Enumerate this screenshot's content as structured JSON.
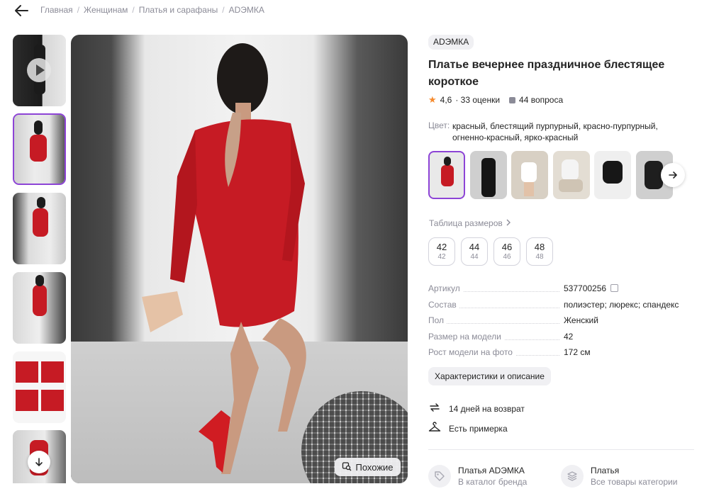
{
  "breadcrumb": {
    "items": [
      "Главная",
      "Женщинам",
      "Платья и сарафаны",
      "ADЭМКА"
    ],
    "separator": "/"
  },
  "gallery": {
    "thumbnails": [
      {
        "kind": "video",
        "selected": false
      },
      {
        "kind": "photo",
        "selected": true
      },
      {
        "kind": "photo",
        "selected": false
      },
      {
        "kind": "photo",
        "selected": false
      },
      {
        "kind": "details",
        "selected": false
      },
      {
        "kind": "photo",
        "selected": false
      }
    ],
    "similar_label": "Похожие"
  },
  "product": {
    "brand": "ADЭМКА",
    "title": "Платье вечернее праздничное блестящее короткое",
    "rating": "4,6",
    "ratings_count": "· 33 оценки",
    "questions": "44 вопроса",
    "color_label": "Цвет:",
    "color_value": "красный, блестящий пурпурный, красно-пурпурный, огненно-красный, ярко-красный",
    "variants": [
      {
        "color": "#c61b24",
        "bg": "#e9e9e9",
        "selected": true
      },
      {
        "color": "#151515",
        "bg": "#cfcfcf",
        "selected": false
      },
      {
        "color": "#ffffff",
        "bg": "#d8d0c4",
        "selected": false
      },
      {
        "color": "#f4f4f4",
        "bg": "#e3ddd3",
        "selected": false
      },
      {
        "color": "#171717",
        "bg": "#efefef",
        "selected": false
      },
      {
        "color": "#1e1e1e",
        "bg": "#cfcfcf",
        "selected": false
      }
    ],
    "size_table_label": "Таблица размеров",
    "sizes": [
      {
        "main": "42",
        "sub": "42"
      },
      {
        "main": "44",
        "sub": "44"
      },
      {
        "main": "46",
        "sub": "46"
      },
      {
        "main": "48",
        "sub": "48"
      }
    ],
    "specs": [
      {
        "key": "Артикул",
        "value": "537700256"
      },
      {
        "key": "Состав",
        "value": "полиэстер; люрекс; спандекс"
      },
      {
        "key": "Пол",
        "value": "Женский"
      },
      {
        "key": "Размер на модели",
        "value": "42"
      },
      {
        "key": "Рост модели на фото",
        "value": "172 см"
      }
    ],
    "characteristics_button": "Характеристики и описание",
    "return_info": "14 дней на возврат",
    "fitting_info": "Есть примерка",
    "brand_link": {
      "title": "Платья ADЭМКА",
      "subtitle": "В каталог бренда"
    },
    "category_link": {
      "title": "Платья",
      "subtitle": "Все товары категории"
    }
  },
  "colors": {
    "accent": "#8d44d6",
    "star": "#f68a2d",
    "muted": "#8b8b97",
    "dress": "#c61b24"
  }
}
